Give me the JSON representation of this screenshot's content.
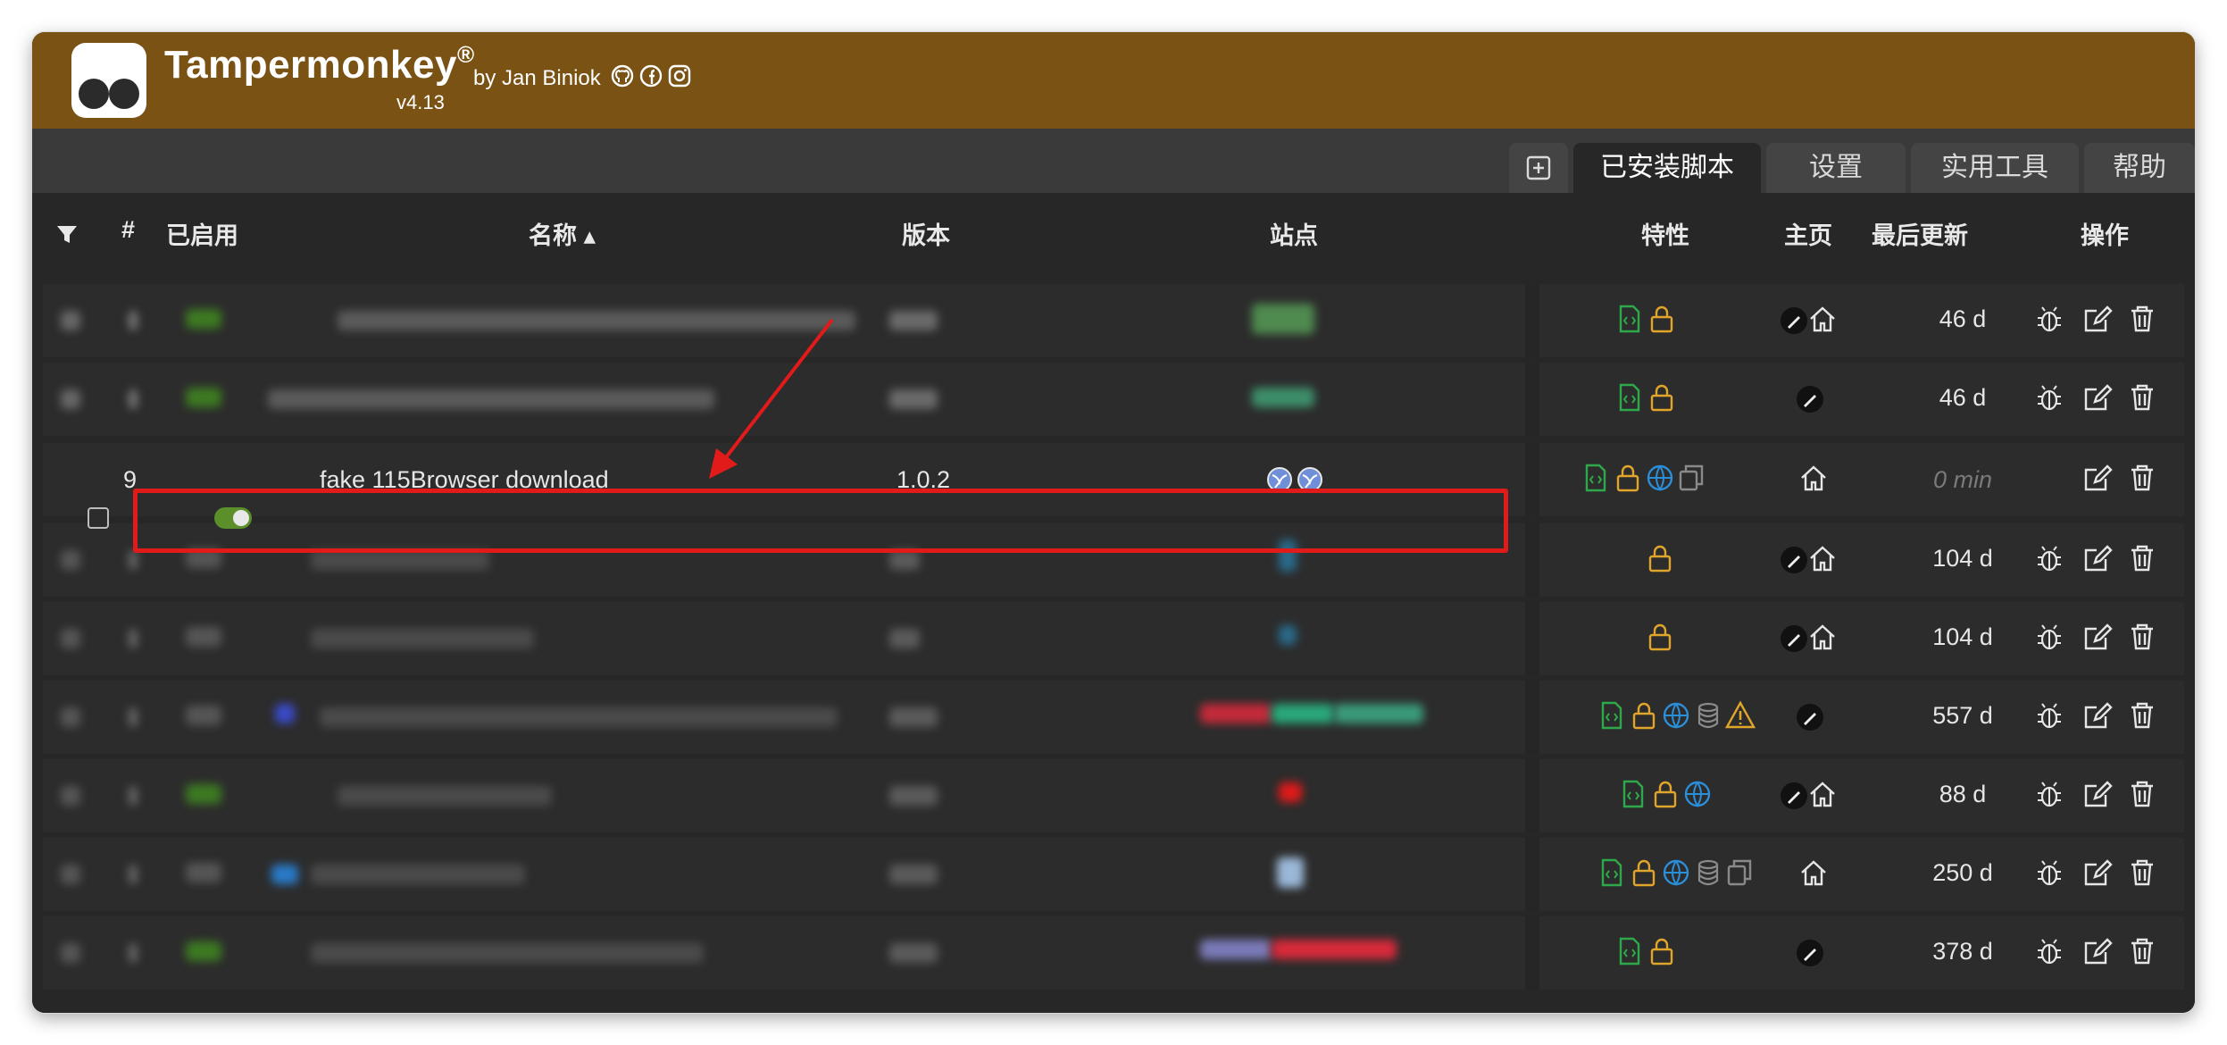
{
  "header": {
    "app_name": "Tampermonkey",
    "registered_mark": "®",
    "byline": "by Jan Biniok",
    "version": "v4.13",
    "social_icons": [
      "github-icon",
      "facebook-icon",
      "instagram-icon"
    ],
    "brand_color": "#7a5214"
  },
  "tabs": {
    "new_icon": "plus-square-icon",
    "installed": "已安装脚本",
    "settings": "设置",
    "utilities": "实用工具",
    "help": "帮助",
    "active": "installed"
  },
  "table": {
    "headers": {
      "filter_icon": "filter-icon",
      "number": "#",
      "enabled": "已启用",
      "name": "名称 ▴",
      "version": "版本",
      "sites": "站点",
      "features": "特性",
      "homepage": "主页",
      "last_updated": "最后更新",
      "actions": "操作"
    },
    "highlight_row": {
      "number": "9",
      "name": "fake 115Browser download",
      "version": "1.0.2",
      "site_icons": [
        "globe-icon",
        "globe-icon"
      ],
      "features": [
        "script-icon",
        "lock-icon",
        "globe-icon",
        "copy-icon"
      ],
      "homepage": [
        "home-icon"
      ],
      "last_updated": "0 min",
      "enabled": true
    },
    "rows_last_updated": [
      "46 d",
      "46 d",
      "0 min",
      "104 d",
      "104 d",
      "557 d",
      "88 d",
      "250 d",
      "378 d"
    ],
    "annotation_color": "#e11a1a"
  }
}
